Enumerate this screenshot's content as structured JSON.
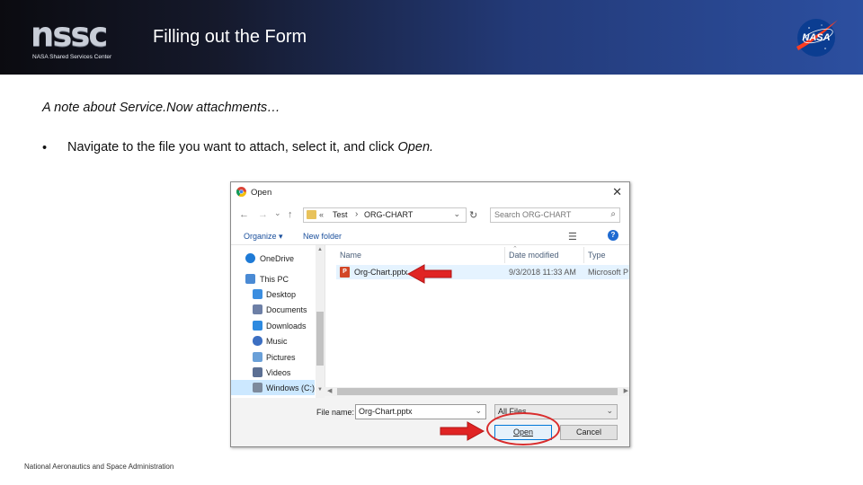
{
  "header": {
    "logo_text": "nssc",
    "logo_subtitle": "NASA Shared Services Center",
    "title": "Filling out the Form",
    "nasa_logo_text": "NASA"
  },
  "content": {
    "heading": "A note about Service.Now attachments…",
    "bullet_dot": "•",
    "bullet_text": "Navigate to the file you want to attach, select it, and click ",
    "bullet_emphasis": "Open."
  },
  "dialog": {
    "title": "Open",
    "close_glyph": "✕",
    "nav": {
      "back": "←",
      "forward": "→",
      "history": "⌄",
      "up": "↑",
      "refresh": "↻"
    },
    "address": {
      "overflow": "«",
      "segment_1": "Test",
      "separator": "›",
      "segment_2": "ORG-CHART",
      "dropdown": "⌄"
    },
    "search_placeholder": "Search ORG-CHART",
    "search_icon": "⌕",
    "toolbar": {
      "organize": "Organize ▾",
      "new_folder": "New folder",
      "view_icon": "☰",
      "help": "?"
    },
    "nav_pane": [
      {
        "label": "OneDrive",
        "icon": "onedrive-icon",
        "color": "#1e7ad6",
        "indent": false,
        "selected": false
      },
      {
        "label": "This PC",
        "icon": "computer-icon",
        "color": "#4a8ad4",
        "indent": false,
        "selected": false
      },
      {
        "label": "Desktop",
        "icon": "desktop-icon",
        "color": "#3c8ee0",
        "indent": true,
        "selected": false
      },
      {
        "label": "Documents",
        "icon": "documents-icon",
        "color": "#6d7fa6",
        "indent": true,
        "selected": false
      },
      {
        "label": "Downloads",
        "icon": "downloads-icon",
        "color": "#2d8ae0",
        "indent": true,
        "selected": false
      },
      {
        "label": "Music",
        "icon": "music-icon",
        "color": "#3c6fc2",
        "indent": true,
        "selected": false
      },
      {
        "label": "Pictures",
        "icon": "pictures-icon",
        "color": "#6aa0d8",
        "indent": true,
        "selected": false
      },
      {
        "label": "Videos",
        "icon": "videos-icon",
        "color": "#5b6f93",
        "indent": true,
        "selected": false
      },
      {
        "label": "Windows (C:)",
        "icon": "drive-icon",
        "color": "#7d8a9c",
        "indent": true,
        "selected": true
      }
    ],
    "columns": {
      "name": "Name",
      "date_modified": "Date modified",
      "type": "Type"
    },
    "files": [
      {
        "name": "Org-Chart.pptx",
        "date_modified": "9/3/2018 11:33 AM",
        "type": "Microsoft P",
        "icon": "powerpoint-file-icon",
        "icon_letter": "P"
      }
    ],
    "file_name_label": "File name:",
    "file_name_value": "Org-Chart.pptx",
    "file_type_value": "All Files",
    "open_button": "Open",
    "cancel_button": "Cancel"
  },
  "annotations": {
    "arrow_color": "#e02424",
    "circle_color": "#d92d2d"
  },
  "footer": "National Aeronautics and Space Administration",
  "colors": {
    "banner_dark": "#0b0b10",
    "banner_blue": "#2c4fa0",
    "nasa_blue": "#0b3d91",
    "nasa_red": "#fc3d21",
    "selection": "#cce8ff"
  }
}
